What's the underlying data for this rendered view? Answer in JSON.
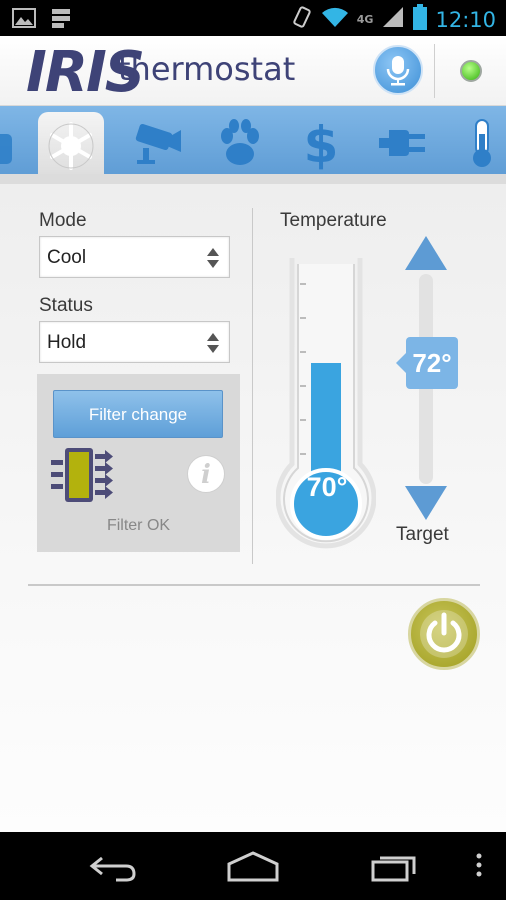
{
  "status_bar": {
    "network": "4G",
    "time": "12:10"
  },
  "header": {
    "logo_brand": "IRIS",
    "logo_product": "thermostat"
  },
  "tabs": [
    {
      "name": "lock",
      "active": false
    },
    {
      "name": "thermostat",
      "active": true
    },
    {
      "name": "camera",
      "active": false
    },
    {
      "name": "pets",
      "active": false
    },
    {
      "name": "energy",
      "active": false
    },
    {
      "name": "plug",
      "active": false
    },
    {
      "name": "temperature",
      "active": false
    }
  ],
  "controls": {
    "mode_label": "Mode",
    "mode_value": "Cool",
    "status_label": "Status",
    "status_value": "Hold",
    "filter_button": "Filter change",
    "filter_status": "Filter OK",
    "info_glyph": "i"
  },
  "temperature": {
    "label": "Temperature",
    "current": "70°",
    "current_level": 0.55,
    "target": "72°",
    "target_label": "Target"
  },
  "colors": {
    "accent": "#5d9bd4",
    "mercury": "#3aa4e0",
    "power": "#b3b039",
    "online": "#3ab416"
  }
}
